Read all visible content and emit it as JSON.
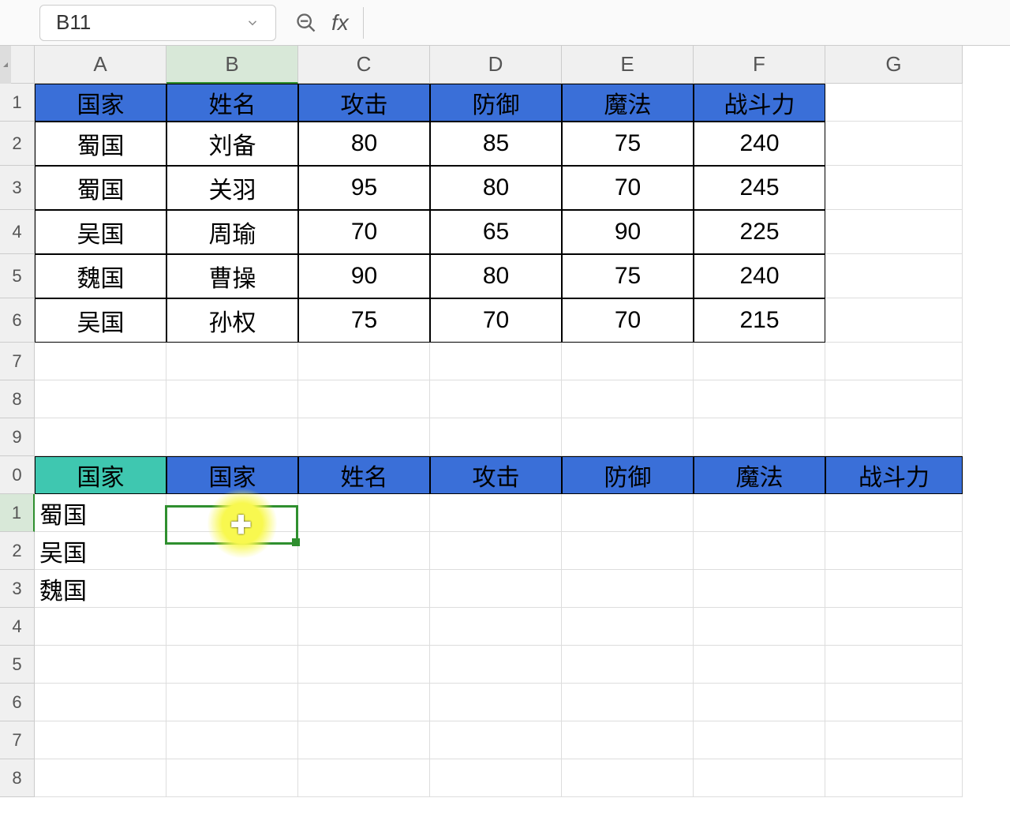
{
  "nameBox": "B11",
  "fxLabel": "fx",
  "colHeaders": [
    "A",
    "B",
    "C",
    "D",
    "E",
    "F",
    "G"
  ],
  "rowHeaders": [
    "1",
    "2",
    "3",
    "4",
    "5",
    "6",
    "7",
    "8",
    "9",
    "0",
    "1",
    "2",
    "3",
    "4",
    "5",
    "6",
    "7",
    "8"
  ],
  "activeCol": "B",
  "activeRow": "1",
  "table1": {
    "headers": [
      "国家",
      "姓名",
      "攻击",
      "防御",
      "魔法",
      "战斗力"
    ],
    "rows": [
      [
        "蜀国",
        "刘备",
        "80",
        "85",
        "75",
        "240"
      ],
      [
        "蜀国",
        "关羽",
        "95",
        "80",
        "70",
        "245"
      ],
      [
        "吴国",
        "周瑜",
        "70",
        "65",
        "90",
        "225"
      ],
      [
        "魏国",
        "曹操",
        "90",
        "80",
        "75",
        "240"
      ],
      [
        "吴国",
        "孙权",
        "75",
        "70",
        "70",
        "215"
      ]
    ]
  },
  "table2": {
    "tealHeader": "国家",
    "blueHeaders": [
      "国家",
      "姓名",
      "攻击",
      "防御",
      "魔法",
      "战斗力"
    ],
    "colA": [
      "蜀国",
      "吴国",
      "魏国"
    ]
  }
}
